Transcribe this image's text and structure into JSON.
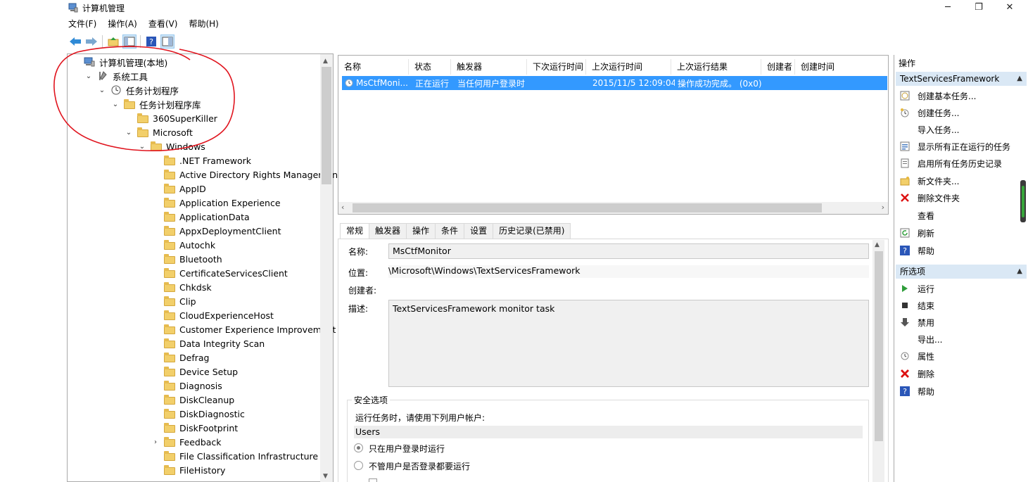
{
  "window": {
    "title": "计算机管理",
    "controls": {
      "minimize": "─",
      "maximize": "❐",
      "close": "✕"
    }
  },
  "menu": [
    "文件(F)",
    "操作(A)",
    "查看(V)",
    "帮助(H)"
  ],
  "toolbar": [
    "back-icon",
    "forward-icon",
    "up-folder-icon",
    "show-hide-tree-icon",
    "help-icon",
    "properties-icon"
  ],
  "tree": {
    "items": [
      {
        "label": "计算机管理(本地)",
        "chevron": "",
        "icon": "computer-management-icon"
      },
      {
        "label": "系统工具",
        "chevron": "⌄",
        "icon": "tools-icon"
      },
      {
        "label": "任务计划程序",
        "chevron": "⌄",
        "icon": "clock-icon"
      },
      {
        "label": "任务计划程序库",
        "chevron": "⌄",
        "icon": "folder-clock-icon"
      },
      {
        "label": "360SuperKiller",
        "chevron": "",
        "icon": "folder-icon"
      },
      {
        "label": "Microsoft",
        "chevron": "⌄",
        "icon": "folder-icon"
      },
      {
        "label": "Windows",
        "chevron": "⌄",
        "icon": "folder-icon"
      },
      {
        "label": ".NET Framework",
        "chevron": "",
        "icon": "folder-icon"
      },
      {
        "label": "Active Directory Rights Management S",
        "chevron": "",
        "icon": "folder-icon"
      },
      {
        "label": "AppID",
        "chevron": "",
        "icon": "folder-icon"
      },
      {
        "label": "Application Experience",
        "chevron": "",
        "icon": "folder-icon"
      },
      {
        "label": "ApplicationData",
        "chevron": "",
        "icon": "folder-icon"
      },
      {
        "label": "AppxDeploymentClient",
        "chevron": "",
        "icon": "folder-icon"
      },
      {
        "label": "Autochk",
        "chevron": "",
        "icon": "folder-icon"
      },
      {
        "label": "Bluetooth",
        "chevron": "",
        "icon": "folder-icon"
      },
      {
        "label": "CertificateServicesClient",
        "chevron": "",
        "icon": "folder-icon"
      },
      {
        "label": "Chkdsk",
        "chevron": "",
        "icon": "folder-icon"
      },
      {
        "label": "Clip",
        "chevron": "",
        "icon": "folder-icon"
      },
      {
        "label": "CloudExperienceHost",
        "chevron": "",
        "icon": "folder-icon"
      },
      {
        "label": "Customer Experience Improvement Pr",
        "chevron": "",
        "icon": "folder-icon"
      },
      {
        "label": "Data Integrity Scan",
        "chevron": "",
        "icon": "folder-icon"
      },
      {
        "label": "Defrag",
        "chevron": "",
        "icon": "folder-icon"
      },
      {
        "label": "Device Setup",
        "chevron": "",
        "icon": "folder-icon"
      },
      {
        "label": "Diagnosis",
        "chevron": "",
        "icon": "folder-icon"
      },
      {
        "label": "DiskCleanup",
        "chevron": "",
        "icon": "folder-icon"
      },
      {
        "label": "DiskDiagnostic",
        "chevron": "",
        "icon": "folder-icon"
      },
      {
        "label": "DiskFootprint",
        "chevron": "",
        "icon": "folder-icon"
      },
      {
        "label": "Feedback",
        "chevron": "›",
        "icon": "folder-icon"
      },
      {
        "label": "File Classification Infrastructure",
        "chevron": "",
        "icon": "folder-icon"
      },
      {
        "label": "FileHistory",
        "chevron": "",
        "icon": "folder-icon"
      }
    ]
  },
  "task_list": {
    "columns": [
      "名称",
      "状态",
      "触发器",
      "下次运行时间",
      "上次运行时间",
      "上次运行结果",
      "创建者",
      "创建时间"
    ],
    "rows": [
      {
        "name": "MsCtfMoni...",
        "status": "正在运行",
        "trigger": "当任何用户登录时",
        "next_run": "",
        "last_run": "2015/11/5 12:09:04",
        "last_result": "操作成功完成。 (0x0)",
        "author": "",
        "created": ""
      }
    ]
  },
  "tabs": [
    "常规",
    "触发器",
    "操作",
    "条件",
    "设置",
    "历史记录(已禁用)"
  ],
  "details": {
    "name_label": "名称:",
    "name_value": "MsCtfMonitor",
    "location_label": "位置:",
    "location_value": "\\Microsoft\\Windows\\TextServicesFramework",
    "author_label": "创建者:",
    "description_label": "描述:",
    "description_value": "TextServicesFramework monitor task",
    "security": {
      "title": "安全选项",
      "run_as_label": "运行任务时，请使用下列用户帐户:",
      "run_as_value": "Users",
      "option_logged_on": "只在用户登录时运行",
      "option_any": "不管用户是否登录都要运行"
    }
  },
  "actions": {
    "header": "操作",
    "section1_title": "TextServicesFramework",
    "section1_items": [
      {
        "label": "创建基本任务...",
        "icon": "create-basic-task-icon"
      },
      {
        "label": "创建任务...",
        "icon": "create-task-icon"
      },
      {
        "label": "导入任务...",
        "icon": ""
      },
      {
        "label": "显示所有正在运行的任务",
        "icon": "running-tasks-icon"
      },
      {
        "label": "启用所有任务历史记录",
        "icon": "history-icon"
      },
      {
        "label": "新文件夹...",
        "icon": "new-folder-icon"
      },
      {
        "label": "删除文件夹",
        "icon": "delete-folder-icon"
      },
      {
        "label": "查看",
        "icon": ""
      },
      {
        "label": "刷新",
        "icon": "refresh-icon"
      },
      {
        "label": "帮助",
        "icon": "help-icon"
      }
    ],
    "section2_title": "所选项",
    "section2_items": [
      {
        "label": "运行",
        "icon": "run-icon"
      },
      {
        "label": "结束",
        "icon": "stop-icon"
      },
      {
        "label": "禁用",
        "icon": "disable-icon"
      },
      {
        "label": "导出...",
        "icon": ""
      },
      {
        "label": "属性",
        "icon": "properties-icon"
      },
      {
        "label": "删除",
        "icon": "delete-icon"
      },
      {
        "label": "帮助",
        "icon": "help-icon"
      }
    ]
  },
  "colors": {
    "selection": "#3399ff",
    "action_header": "#dae8f5",
    "annotation": "#e0141e"
  }
}
